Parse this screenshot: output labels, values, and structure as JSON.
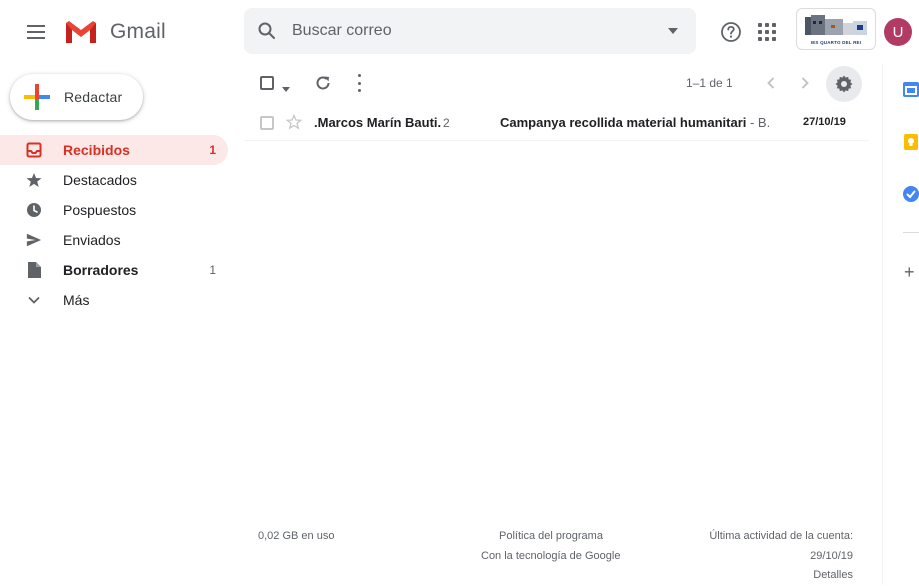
{
  "header": {
    "app_name": "Gmail",
    "search_placeholder": "Buscar correo",
    "org_logo_text": "IES QUARTO DEL REI",
    "avatar_letter": "U"
  },
  "compose": {
    "label": "Redactar"
  },
  "nav": {
    "items": [
      {
        "label": "Recibidos",
        "count": "1",
        "icon": "inbox-icon"
      },
      {
        "label": "Destacados",
        "count": "",
        "icon": "star-icon"
      },
      {
        "label": "Pospuestos",
        "count": "",
        "icon": "clock-icon"
      },
      {
        "label": "Enviados",
        "count": "",
        "icon": "send-icon"
      },
      {
        "label": "Borradores",
        "count": "1",
        "icon": "draft-icon"
      },
      {
        "label": "Más",
        "count": "",
        "icon": "chevron-down-icon"
      }
    ]
  },
  "toolbar": {
    "range": "1–1 de 1"
  },
  "emails": [
    {
      "sender": ".Marcos Marín Bauti.",
      "thread_count": "2",
      "subject": "Campanya recollida material humanitari",
      "snippet": " - B..",
      "date": "27/10/19"
    }
  ],
  "footer": {
    "usage": "0,02 GB en uso",
    "policy": "Política del programa",
    "powered": "Con la tecnología de Google",
    "activity_label": "Última actividad de la cuenta:",
    "activity_date": "29/10/19",
    "details": "Detalles"
  },
  "colors": {
    "accent_red": "#d93025",
    "active_bg": "#fce8e6",
    "avatar_bg": "#b23b63"
  }
}
